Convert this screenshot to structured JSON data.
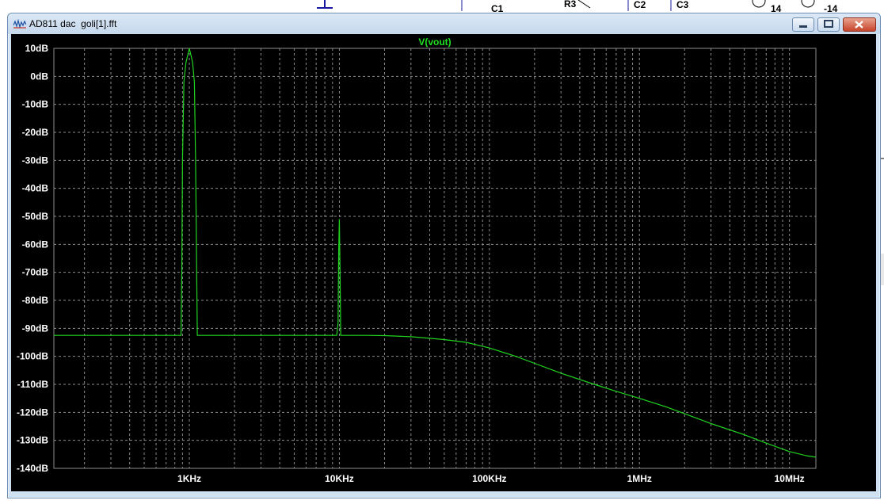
{
  "background": {
    "labels": [
      "C1",
      "R3",
      "C2",
      "C3",
      "14",
      "-14"
    ]
  },
  "window": {
    "title": "AD811 dac  goli[1].fft",
    "buttons": {
      "minimize": "minimize",
      "maximize": "maximize",
      "close": "close"
    }
  },
  "colors": {
    "plot_bg": "#000000",
    "grid": "#8c8c8c",
    "trace": "#21d321",
    "axis_text": "#ffffff",
    "series_title": "#21e021"
  },
  "chart_data": {
    "type": "line",
    "title": "V(vout)",
    "x_scale": "log",
    "xlim": [
      125,
      15000000
    ],
    "ylim": [
      -140,
      10
    ],
    "y_ticks": [
      10,
      0,
      -10,
      -20,
      -30,
      -40,
      -50,
      -60,
      -70,
      -80,
      -90,
      -100,
      -110,
      -120,
      -130,
      -140
    ],
    "y_tick_labels": [
      "10dB",
      "0dB",
      "-10dB",
      "-20dB",
      "-30dB",
      "-40dB",
      "-50dB",
      "-60dB",
      "-70dB",
      "-80dB",
      "-90dB",
      "-100dB",
      "-110dB",
      "-120dB",
      "-130dB",
      "-140dB"
    ],
    "x_ticks": [
      1000,
      10000,
      100000,
      1000000,
      10000000
    ],
    "x_tick_labels": [
      "1KHz",
      "10KHz",
      "100KHz",
      "1MHz",
      "10MHz"
    ],
    "grid": true,
    "series": [
      {
        "name": "V(vout)",
        "x": [
          125,
          830,
          880,
          890,
          900,
          920,
          950,
          980,
          1000,
          1020,
          1050,
          1080,
          1100,
          1130,
          1200,
          5000,
          9600,
          9800,
          9900,
          10000,
          10100,
          10200,
          10400,
          15000,
          20000,
          30000,
          50000,
          70000,
          100000,
          150000,
          200000,
          300000,
          500000,
          700000,
          1000000,
          1500000,
          2000000,
          3000000,
          5000000,
          7000000,
          10000000,
          13000000,
          15000000
        ],
        "y": [
          -92.5,
          -92.5,
          -92.5,
          -70,
          -30,
          -2,
          5,
          8,
          10,
          8,
          5,
          -2,
          -30,
          -92.5,
          -92.5,
          -92.5,
          -92.5,
          -88,
          -62,
          -51,
          -70,
          -92.5,
          -92.5,
          -92.5,
          -92.6,
          -93,
          -94,
          -95,
          -97,
          -100,
          -102.5,
          -106,
          -110,
          -112.5,
          -115,
          -118,
          -120.5,
          -124,
          -128,
          -131,
          -134,
          -135.5,
          -136
        ]
      }
    ]
  }
}
